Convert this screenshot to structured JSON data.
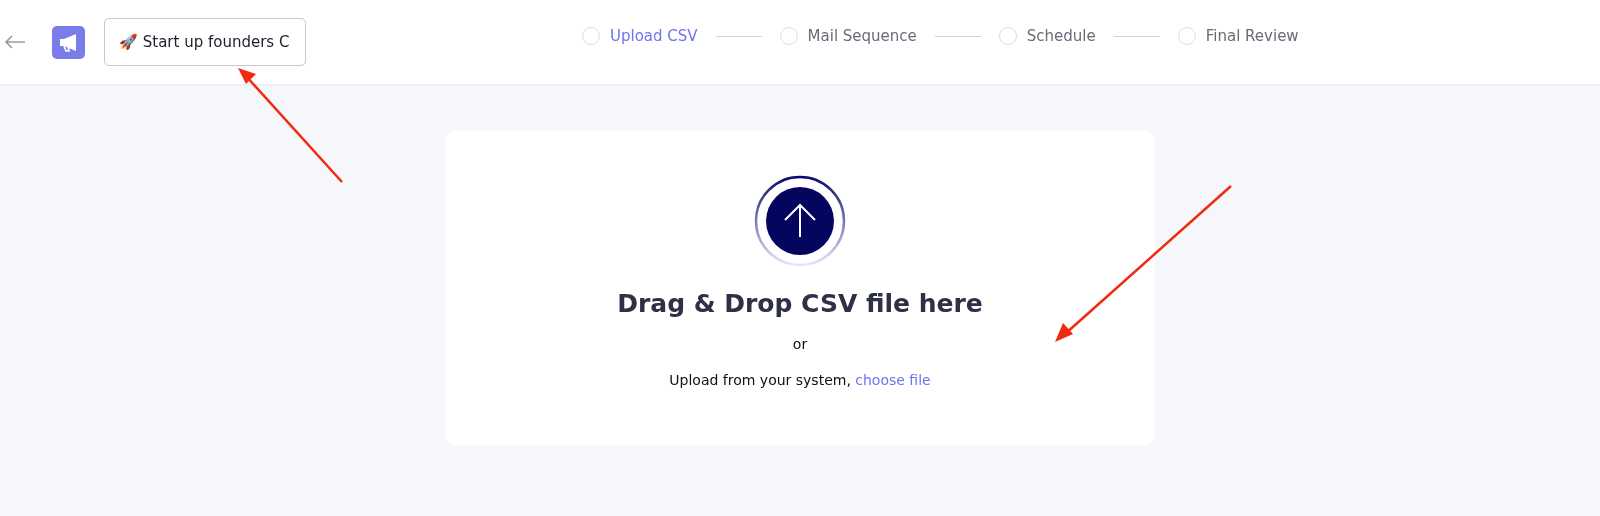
{
  "header": {
    "campaign_name": "🚀 Start up founders C"
  },
  "steps": [
    {
      "label": "Upload CSV",
      "selected": true
    },
    {
      "label": "Mail Sequence",
      "selected": false
    },
    {
      "label": "Schedule",
      "selected": false
    },
    {
      "label": "Final Review",
      "selected": false
    }
  ],
  "upload": {
    "heading": "Drag & Drop CSV file here",
    "separator": "or",
    "prompt": "Upload from your system,",
    "link": "choose file"
  }
}
